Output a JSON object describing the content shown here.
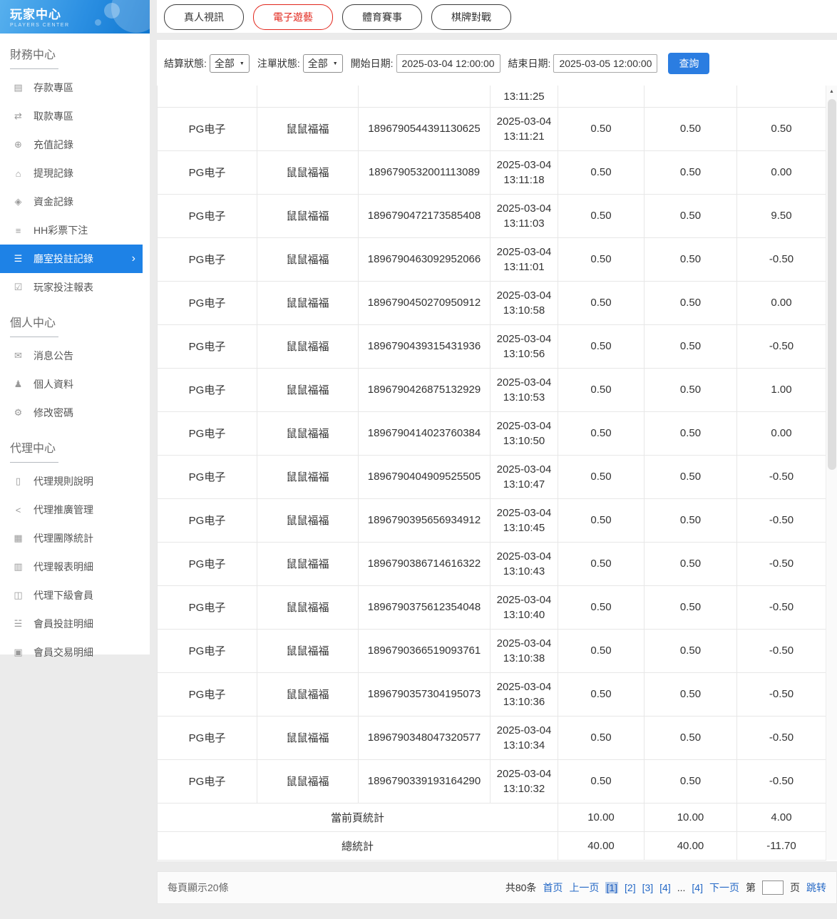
{
  "sidebar": {
    "title": "玩家中心",
    "subtitle": "PLAYERS CENTER",
    "sections": [
      {
        "title": "財務中心",
        "items": [
          {
            "label": "存款專區",
            "icon": "▤",
            "icon_name": "deposit-icon",
            "active": false
          },
          {
            "label": "取款專區",
            "icon": "⇄",
            "icon_name": "withdraw-icon",
            "active": false
          },
          {
            "label": "充值記錄",
            "icon": "⊕",
            "icon_name": "recharge-record-icon",
            "active": false
          },
          {
            "label": "提現記錄",
            "icon": "⌂",
            "icon_name": "withdrawal-record-icon",
            "active": false
          },
          {
            "label": "資金記錄",
            "icon": "◈",
            "icon_name": "funds-record-icon",
            "active": false
          },
          {
            "label": "HH彩票下注",
            "icon": "≡",
            "icon_name": "lottery-bet-icon",
            "active": false
          },
          {
            "label": "廳室投註記錄",
            "icon": "☰",
            "icon_name": "room-bet-record-icon",
            "active": true
          },
          {
            "label": "玩家投注報表",
            "icon": "☑",
            "icon_name": "player-bet-report-icon",
            "active": false
          }
        ]
      },
      {
        "title": "個人中心",
        "items": [
          {
            "label": "消息公告",
            "icon": "✉",
            "icon_name": "bell-icon",
            "active": false
          },
          {
            "label": "個人資料",
            "icon": "♟",
            "icon_name": "user-icon",
            "active": false
          },
          {
            "label": "修改密碼",
            "icon": "⚙",
            "icon_name": "gear-icon",
            "active": false
          }
        ]
      },
      {
        "title": "代理中心",
        "items": [
          {
            "label": "代理規則說明",
            "icon": "▯",
            "icon_name": "document-icon",
            "active": false
          },
          {
            "label": "代理推廣管理",
            "icon": "<",
            "icon_name": "share-icon",
            "active": false
          },
          {
            "label": "代理團隊統計",
            "icon": "▦",
            "icon_name": "team-stats-icon",
            "active": false
          },
          {
            "label": "代理報表明細",
            "icon": "▥",
            "icon_name": "report-detail-icon",
            "active": false
          },
          {
            "label": "代理下級會員",
            "icon": "◫",
            "icon_name": "members-icon",
            "active": false
          },
          {
            "label": "會員投註明細",
            "icon": "☱",
            "icon_name": "bet-detail-icon",
            "active": false
          },
          {
            "label": "會員交易明細",
            "icon": "▣",
            "icon_name": "transaction-detail-icon",
            "active": false
          }
        ]
      }
    ]
  },
  "tabs": [
    {
      "label": "真人視訊",
      "active": false
    },
    {
      "label": "電子遊藝",
      "active": true
    },
    {
      "label": "體育賽事",
      "active": false
    },
    {
      "label": "棋牌對戰",
      "active": false
    }
  ],
  "filters": {
    "settle_label": "結算狀態:",
    "settle_value": "全部",
    "order_label": "注單狀態:",
    "order_value": "全部",
    "start_label": "開始日期:",
    "start_value": "2025-03-04 12:00:00",
    "end_label": "結束日期:",
    "end_value": "2025-03-05 12:00:00",
    "query_label": "查詢"
  },
  "table": {
    "partial_row_time": "13:11:25",
    "rows": [
      {
        "provider": "PG电子",
        "game": "鼠鼠福福",
        "order_id": "1896790544391130625",
        "date": "2025-03-04",
        "time": "13:11:21",
        "bet": "0.50",
        "valid": "0.50",
        "win": "0.50"
      },
      {
        "provider": "PG电子",
        "game": "鼠鼠福福",
        "order_id": "1896790532001113089",
        "date": "2025-03-04",
        "time": "13:11:18",
        "bet": "0.50",
        "valid": "0.50",
        "win": "0.00"
      },
      {
        "provider": "PG电子",
        "game": "鼠鼠福福",
        "order_id": "1896790472173585408",
        "date": "2025-03-04",
        "time": "13:11:03",
        "bet": "0.50",
        "valid": "0.50",
        "win": "9.50"
      },
      {
        "provider": "PG电子",
        "game": "鼠鼠福福",
        "order_id": "1896790463092952066",
        "date": "2025-03-04",
        "time": "13:11:01",
        "bet": "0.50",
        "valid": "0.50",
        "win": "-0.50"
      },
      {
        "provider": "PG电子",
        "game": "鼠鼠福福",
        "order_id": "1896790450270950912",
        "date": "2025-03-04",
        "time": "13:10:58",
        "bet": "0.50",
        "valid": "0.50",
        "win": "0.00"
      },
      {
        "provider": "PG电子",
        "game": "鼠鼠福福",
        "order_id": "1896790439315431936",
        "date": "2025-03-04",
        "time": "13:10:56",
        "bet": "0.50",
        "valid": "0.50",
        "win": "-0.50"
      },
      {
        "provider": "PG电子",
        "game": "鼠鼠福福",
        "order_id": "1896790426875132929",
        "date": "2025-03-04",
        "time": "13:10:53",
        "bet": "0.50",
        "valid": "0.50",
        "win": "1.00"
      },
      {
        "provider": "PG电子",
        "game": "鼠鼠福福",
        "order_id": "1896790414023760384",
        "date": "2025-03-04",
        "time": "13:10:50",
        "bet": "0.50",
        "valid": "0.50",
        "win": "0.00"
      },
      {
        "provider": "PG电子",
        "game": "鼠鼠福福",
        "order_id": "1896790404909525505",
        "date": "2025-03-04",
        "time": "13:10:47",
        "bet": "0.50",
        "valid": "0.50",
        "win": "-0.50"
      },
      {
        "provider": "PG电子",
        "game": "鼠鼠福福",
        "order_id": "1896790395656934912",
        "date": "2025-03-04",
        "time": "13:10:45",
        "bet": "0.50",
        "valid": "0.50",
        "win": "-0.50"
      },
      {
        "provider": "PG电子",
        "game": "鼠鼠福福",
        "order_id": "1896790386714616322",
        "date": "2025-03-04",
        "time": "13:10:43",
        "bet": "0.50",
        "valid": "0.50",
        "win": "-0.50"
      },
      {
        "provider": "PG电子",
        "game": "鼠鼠福福",
        "order_id": "1896790375612354048",
        "date": "2025-03-04",
        "time": "13:10:40",
        "bet": "0.50",
        "valid": "0.50",
        "win": "-0.50"
      },
      {
        "provider": "PG电子",
        "game": "鼠鼠福福",
        "order_id": "1896790366519093761",
        "date": "2025-03-04",
        "time": "13:10:38",
        "bet": "0.50",
        "valid": "0.50",
        "win": "-0.50"
      },
      {
        "provider": "PG电子",
        "game": "鼠鼠福福",
        "order_id": "1896790357304195073",
        "date": "2025-03-04",
        "time": "13:10:36",
        "bet": "0.50",
        "valid": "0.50",
        "win": "-0.50"
      },
      {
        "provider": "PG电子",
        "game": "鼠鼠福福",
        "order_id": "1896790348047320577",
        "date": "2025-03-04",
        "time": "13:10:34",
        "bet": "0.50",
        "valid": "0.50",
        "win": "-0.50"
      },
      {
        "provider": "PG电子",
        "game": "鼠鼠福福",
        "order_id": "1896790339193164290",
        "date": "2025-03-04",
        "time": "13:10:32",
        "bet": "0.50",
        "valid": "0.50",
        "win": "-0.50"
      }
    ],
    "page_total": {
      "label": "當前頁統計",
      "bet": "10.00",
      "valid": "10.00",
      "win": "4.00"
    },
    "grand_total": {
      "label": "總統計",
      "bet": "40.00",
      "valid": "40.00",
      "win": "-11.70"
    }
  },
  "pagination": {
    "per_page": "每頁顯示20條",
    "total_count": "共80条",
    "first": "首页",
    "prev": "上一页",
    "pages": [
      {
        "label": "[1]",
        "current": true
      },
      {
        "label": "[2]",
        "current": false
      },
      {
        "label": "[3]",
        "current": false
      },
      {
        "label": "[4]",
        "current": false
      },
      {
        "label": "...",
        "ellipsis": true
      },
      {
        "label": "[4]",
        "current": false
      }
    ],
    "next": "下一页",
    "jump_prefix": "第",
    "jump_value": "",
    "jump_suffix": "页",
    "jump_action": "跳转"
  },
  "colors": {
    "accent_blue": "#1e82e6",
    "active_tab_red": "#e1251b",
    "link_blue": "#2468c6"
  }
}
